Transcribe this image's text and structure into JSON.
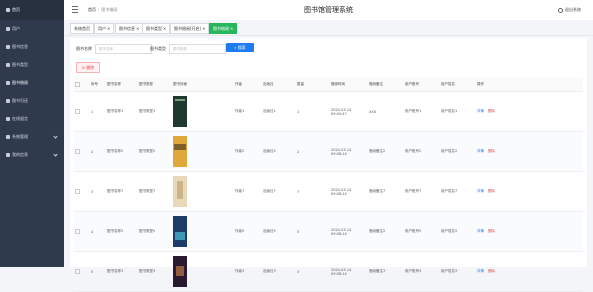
{
  "sidebar": {
    "brand": "首页",
    "items": [
      {
        "label": "用户",
        "expandable": false
      },
      {
        "label": "图书信息",
        "expandable": false
      },
      {
        "label": "图书类型",
        "expandable": false
      },
      {
        "label": "图书借阅",
        "expandable": false
      },
      {
        "label": "图书归还",
        "expandable": false
      },
      {
        "label": "在线留言",
        "expandable": false
      },
      {
        "label": "系统管理",
        "expandable": true
      },
      {
        "label": "我的信息",
        "expandable": true
      }
    ]
  },
  "header": {
    "breadcrumb": [
      "首页",
      "图书借阅"
    ],
    "title": "图书馆管理系统",
    "quit": "退出系统"
  },
  "tabs": [
    {
      "label": "系统首页",
      "closable": false,
      "active": false
    },
    {
      "label": "用户",
      "closable": true,
      "active": false
    },
    {
      "label": "图书信息",
      "closable": true,
      "active": false
    },
    {
      "label": "图书类型",
      "closable": true,
      "active": false
    },
    {
      "label": "图书借阅(开启)",
      "closable": true,
      "active": false
    },
    {
      "label": "图书借阅",
      "closable": true,
      "active": true
    }
  ],
  "filters": {
    "name_label": "图书名称",
    "name_placeholder": "图书名称",
    "type_label": "图书类型",
    "type_placeholder": "图书类型",
    "search": "搜索"
  },
  "delete_button": "删除",
  "table": {
    "columns": [
      "序号",
      "图书名称",
      "图书类型",
      "图书封面",
      "作者",
      "出版社",
      "数量",
      "借阅时间",
      "借阅备注",
      "用户账号",
      "用户姓名",
      "操作"
    ],
    "rows": [
      {
        "index": "1",
        "name": "图书名称1",
        "type": "图书类型1",
        "author": "作者1",
        "publisher": "出版社1",
        "count": "1",
        "time": "2024-03-14 09:00:47",
        "note": "XXX",
        "account": "用户账号1",
        "uname": "用户姓名1",
        "cover": "#1e3a2e"
      },
      {
        "index": "2",
        "name": "图书名称2",
        "type": "图书类型2",
        "author": "作者2",
        "publisher": "出版社2",
        "count": "2",
        "time": "2024-03-14 09:08:14",
        "note": "借阅备注2",
        "account": "用户账号2",
        "uname": "用户姓名2",
        "cover": "#e0a83a"
      },
      {
        "index": "3",
        "name": "图书名称7",
        "type": "图书类型7",
        "author": "作者7",
        "publisher": "出版社7",
        "count": "7",
        "time": "2024-03-14 09:08:14",
        "note": "借阅备注7",
        "account": "用户账号7",
        "uname": "用户姓名7",
        "cover": "#e9d9b8"
      },
      {
        "index": "4",
        "name": "图书名称5",
        "type": "图书类型5",
        "author": "作者5",
        "publisher": "出版社5",
        "count": "5",
        "time": "2024-03-14 09:08:14",
        "note": "借阅备注5",
        "account": "用户账号5",
        "uname": "用户姓名5",
        "cover": "#1c3d6a"
      },
      {
        "index": "5",
        "name": "图书名称3",
        "type": "图书类型3",
        "author": "作者3",
        "publisher": "出版社3",
        "count": "3",
        "time": "2024-03-14 09:08:14",
        "note": "借阅备注3",
        "account": "用户账号3",
        "uname": "用户姓名3",
        "cover": "#2a1a30"
      }
    ],
    "op_view": "详情",
    "op_delete": "删除"
  },
  "colors": {
    "sidebar": "#2f3a4d",
    "accent": "#27b65b",
    "primary": "#1e7bf0",
    "danger": "#e04b4b"
  }
}
